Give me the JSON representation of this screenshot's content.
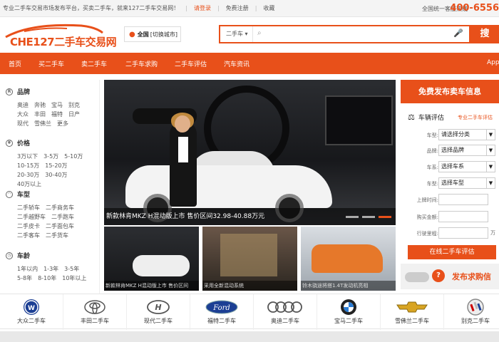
{
  "topbar": {
    "intro": "专业二手车交易市场发布平台，买卖二手车，就来127二手车交易网！",
    "login": "请登录",
    "register": "免费注册",
    "favorite": "收藏",
    "hotline_label": "全国统一客服热线",
    "phone": "400-6556"
  },
  "logo": {
    "text": "CHE127二手车交易网"
  },
  "city": {
    "name": "全国",
    "switch": "[切换城市]"
  },
  "search": {
    "category": "二手车",
    "placeholder": "",
    "button": "搜"
  },
  "nav": {
    "items": [
      "首页",
      "买二手车",
      "卖二手车",
      "二手车求购",
      "二手车评估",
      "汽车资讯",
      "App"
    ]
  },
  "filters": {
    "brand": {
      "title": "品牌",
      "items": [
        "奥迪",
        "奔驰",
        "宝马",
        "别克",
        "大众",
        "丰田",
        "福特",
        "日产",
        "现代",
        "雪佛兰",
        "更多"
      ]
    },
    "price": {
      "title": "价格",
      "items": [
        "3万以下",
        "3-5万",
        "5-10万",
        "10-15万",
        "15-20万",
        "20-30万",
        "30-40万",
        "40万以上"
      ]
    },
    "type": {
      "title": "车型",
      "items": [
        "二手轿车",
        "二手商务车",
        "二手越野车",
        "二手跑车",
        "二手皮卡",
        "二手面包车",
        "二手客车",
        "二手货车"
      ]
    },
    "age": {
      "title": "车龄",
      "items": [
        "1年以内",
        "1-3年",
        "3-5年",
        "5-8年",
        "8-10年",
        "10年以上"
      ]
    }
  },
  "hero": {
    "caption": "新款林肯MKZ H混动版上市 售价区间32.98-40.88万元",
    "slides": 3,
    "active_slide": 3
  },
  "thumbs": [
    {
      "caption": "新款林肯MKZ H混动版上市 售价区间"
    },
    {
      "caption": "采用全新混动系统"
    },
    {
      "caption": "铃木骁途将搭1.4T发动机亮相"
    }
  ],
  "sidebar": {
    "publish_sale": "免费发布卖车信息",
    "eval_title": "车辆评估",
    "eval_link": "专业二手车评估",
    "fields": [
      {
        "label": "车型:",
        "value": "请选择分类"
      },
      {
        "label": "品牌:",
        "value": "选择品牌"
      },
      {
        "label": "车系:",
        "value": "选择车系"
      },
      {
        "label": "车型:",
        "value": "选择车型"
      }
    ],
    "inputs": [
      {
        "label": "上牌时间:",
        "unit": ""
      },
      {
        "label": "购买金额:",
        "unit": ""
      },
      {
        "label": "行驶里程:",
        "unit": "万"
      }
    ],
    "online_eval": "在线二手车评估",
    "publish_buy": "发布求购信"
  },
  "brands": [
    {
      "name": "大众二手车",
      "icon": "vw-logo-icon"
    },
    {
      "name": "丰田二手车",
      "icon": "toyota-logo-icon"
    },
    {
      "name": "现代二手车",
      "icon": "hyundai-logo-icon"
    },
    {
      "name": "福特二手车",
      "icon": "ford-logo-icon"
    },
    {
      "name": "奥迪二手车",
      "icon": "audi-logo-icon"
    },
    {
      "name": "宝马二手车",
      "icon": "bmw-logo-icon"
    },
    {
      "name": "雪佛兰二手车",
      "icon": "chevrolet-logo-icon"
    },
    {
      "name": "别克二手车",
      "icon": "buick-logo-icon"
    }
  ],
  "colors": {
    "accent": "#e8501a",
    "nav_bg": "#e8501a",
    "topbar_bg": "#f4f4f4"
  }
}
